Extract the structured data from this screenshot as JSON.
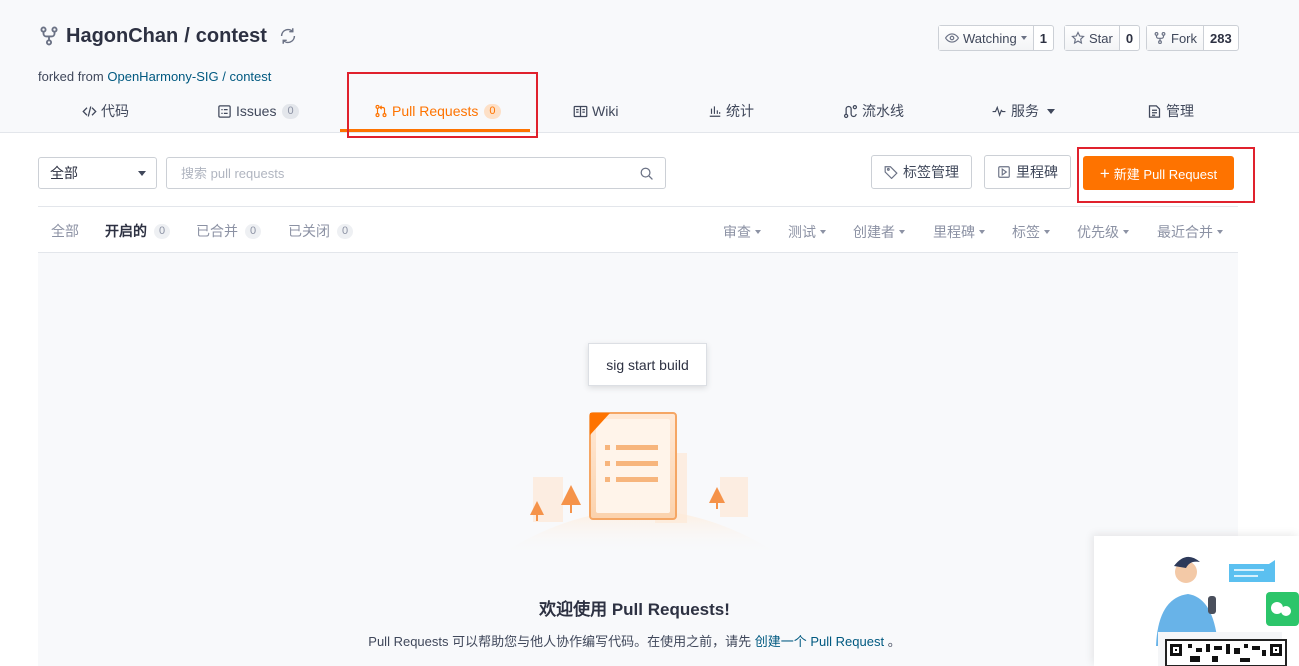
{
  "repo": {
    "owner": "HagonChan",
    "separator": "/",
    "name": "contest",
    "forked_prefix": "forked from",
    "forked_source": "OpenHarmony-SIG / contest"
  },
  "social": {
    "watch_label": "Watching",
    "watch_count": "1",
    "star_label": "Star",
    "star_count": "0",
    "fork_label": "Fork",
    "fork_count": "283"
  },
  "nav": {
    "items": [
      {
        "label": "代码",
        "icon": "code-icon"
      },
      {
        "label": "Issues",
        "badge": "0",
        "icon": "issues-icon"
      },
      {
        "label": "Pull Requests",
        "badge": "0",
        "icon": "pull-request-icon",
        "active": true
      },
      {
        "label": "Wiki",
        "icon": "wiki-icon"
      },
      {
        "label": "统计",
        "icon": "stats-icon"
      },
      {
        "label": "流水线",
        "icon": "pipeline-icon"
      },
      {
        "label": "服务",
        "icon": "service-icon",
        "dropdown": true
      },
      {
        "label": "管理",
        "icon": "manage-icon"
      }
    ]
  },
  "toolbar": {
    "filter_value": "全部",
    "search_placeholder": "搜索 pull requests",
    "label_manage": "标签管理",
    "milestone": "里程碑",
    "new_pr_plus": "+",
    "new_pr": "新建 Pull Request"
  },
  "state_tabs": [
    {
      "label": "全部"
    },
    {
      "label": "开启的",
      "badge": "0",
      "active": true
    },
    {
      "label": "已合并",
      "badge": "0"
    },
    {
      "label": "已关闭",
      "badge": "0"
    }
  ],
  "sort_filters": [
    "审查",
    "测试",
    "创建者",
    "里程碑",
    "标签",
    "优先级",
    "最近合并"
  ],
  "tooltip": "sig start build",
  "empty": {
    "title": "欢迎使用 Pull Requests!",
    "desc_before": "Pull Requests 可以帮助您与他人协作编写代码。在使用之前，请先",
    "desc_link": "创建一个 Pull Request",
    "desc_after": "。"
  },
  "colors": {
    "accent": "#fe7300",
    "link": "#005980",
    "highlight": "#e0212d"
  }
}
